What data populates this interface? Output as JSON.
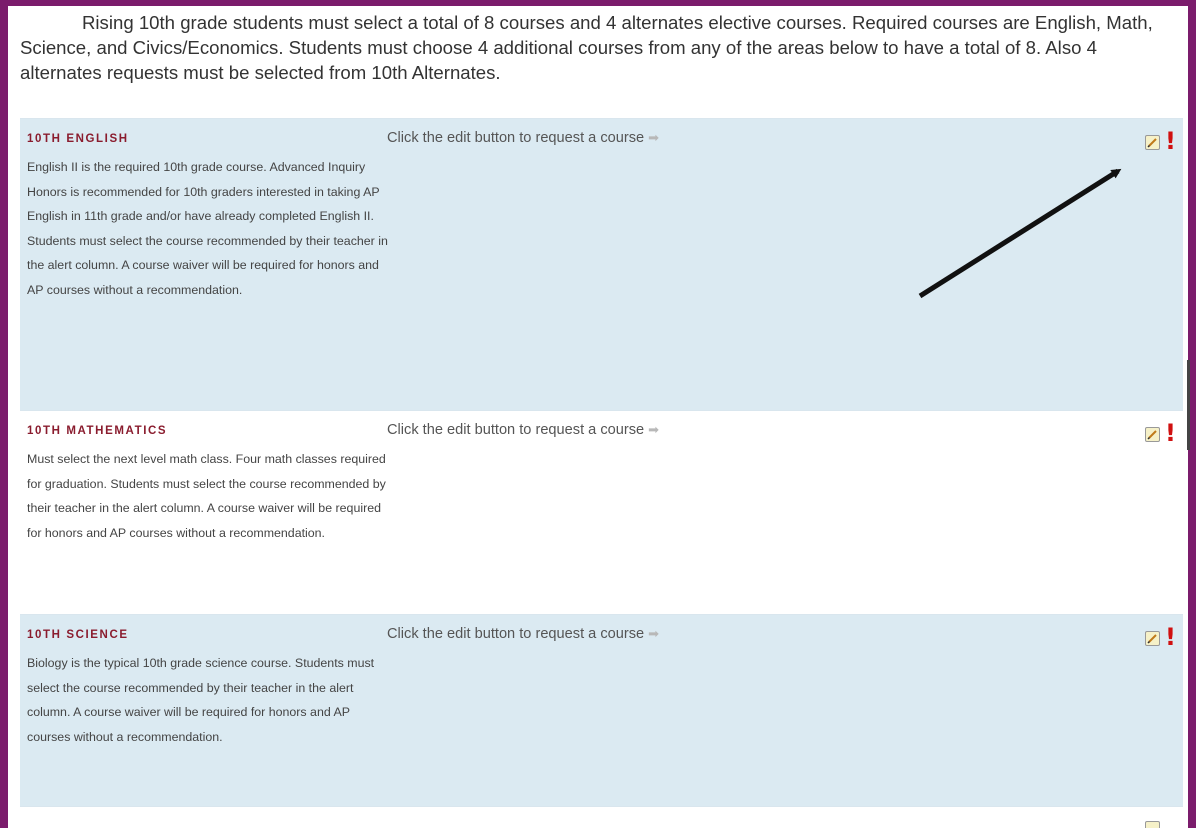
{
  "intro": "Rising 10th grade students must select a total of 8 courses and 4 alternates elective courses. Required courses are English, Math, Science, and Civics/Economics. Students must choose 4 additional courses from any of the areas below to have a total of 8. Also 4 alternates requests must be selected from 10th Alternates.",
  "sections": [
    {
      "title": "10th English",
      "description": "English II is the required 10th grade course. Advanced Inquiry Honors is recommended for 10th graders interested in taking AP English in 11th grade and/or have already completed English II. Students must select the course recommended by their teacher in the alert column. A course waiver will be required for honors and AP courses without a recommendation.",
      "prompt": "Click the edit button to request a course",
      "prompt_icon": "right-arrow-icon",
      "alert": "!"
    },
    {
      "title": "10th Mathematics",
      "description": "Must select the next level math class. Four math classes required for graduation. Students must select the course recommended by their teacher in the alert column. A course waiver will be required for honors and AP courses without a recommendation.",
      "prompt": "Click the edit button to request a course",
      "prompt_icon": "right-arrow-icon",
      "alert": "!"
    },
    {
      "title": "10th Science",
      "description": "Biology is the typical 10th grade science course. Students must select the course recommended by their teacher in the alert column. A course waiver will be required for honors and AP courses without a recommendation.",
      "prompt": "Click the edit button to request a course",
      "prompt_icon": "right-arrow-icon",
      "alert": "!"
    }
  ],
  "colors": {
    "frame": "#7b1c6c",
    "row_blue": "#dbeaf2",
    "title": "#8a1c2e",
    "alert": "#d01010"
  }
}
